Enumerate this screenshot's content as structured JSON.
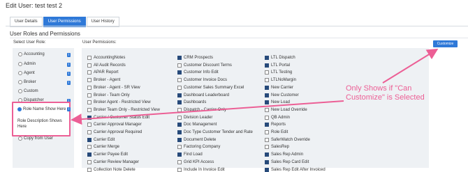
{
  "window": {
    "title": "Edit User: test test 2"
  },
  "tabs": [
    {
      "label": "User Details"
    },
    {
      "label": "User Permissions"
    },
    {
      "label": "User History"
    }
  ],
  "section": {
    "title": "User Roles and Permissions"
  },
  "roles": {
    "heading": "Select User Role:",
    "items": [
      {
        "label": "Accounting"
      },
      {
        "label": "Admin"
      },
      {
        "label": "Agent"
      },
      {
        "label": "Broker"
      },
      {
        "label": "Custom"
      },
      {
        "label": "Dispatcher"
      },
      {
        "label": "Role Name Show Here"
      },
      {
        "label": "Copy from User"
      }
    ],
    "description": "Role Description Shows Here"
  },
  "permissions": {
    "heading": "User Permissions:",
    "columns": [
      [
        {
          "label": "AccountingNotes",
          "checked": false
        },
        {
          "label": "All Audit Records",
          "checked": false
        },
        {
          "label": "APAR Report",
          "checked": false
        },
        {
          "label": "Broker - Agent",
          "checked": false
        },
        {
          "label": "Broker - Agent - SR View",
          "checked": false
        },
        {
          "label": "Broker - Team Only",
          "checked": false
        },
        {
          "label": "Broker Agent - Restricted View",
          "checked": false
        },
        {
          "label": "Broker Team Only - Restricted View",
          "checked": false
        },
        {
          "label": "Carrier / Customer Status Edit",
          "checked": true
        },
        {
          "label": "Carrier Approval Manager",
          "checked": false
        },
        {
          "label": "Carrier Approval Required",
          "checked": false
        },
        {
          "label": "Carrier Edit",
          "checked": true
        },
        {
          "label": "Carrier Merge",
          "checked": false
        },
        {
          "label": "Carrier Payee Edit",
          "checked": true
        },
        {
          "label": "Carrier Review Manager",
          "checked": false
        },
        {
          "label": "Collection Note Delete",
          "checked": false
        }
      ],
      [
        {
          "label": "CRM Prospects",
          "checked": true
        },
        {
          "label": "Customer Discount Terms",
          "checked": false
        },
        {
          "label": "Customer Info Edit",
          "checked": true
        },
        {
          "label": "Customer Invoice Docs",
          "checked": false
        },
        {
          "label": "Customer Sales Summary Excel",
          "checked": false
        },
        {
          "label": "Dashboard Leaderboard",
          "checked": true
        },
        {
          "label": "Dashboards",
          "checked": true
        },
        {
          "label": "Dispatch - Carrier Only",
          "checked": false
        },
        {
          "label": "Division Leader",
          "checked": false
        },
        {
          "label": "Doc Management",
          "checked": true
        },
        {
          "label": "Doc Type Customer Tender and Rate",
          "checked": true
        },
        {
          "label": "Document Delete",
          "checked": true
        },
        {
          "label": "Factoring Company",
          "checked": false
        },
        {
          "label": "Find Load",
          "checked": true
        },
        {
          "label": "Grid KPI Access",
          "checked": false
        },
        {
          "label": "Include In Invoice Edit",
          "checked": false
        }
      ],
      [
        {
          "label": "LTL Dispatch",
          "checked": true
        },
        {
          "label": "LTL Portal",
          "checked": true
        },
        {
          "label": "LTL Testing",
          "checked": false
        },
        {
          "label": "LTLNoMargin",
          "checked": false
        },
        {
          "label": "New Carrier",
          "checked": true
        },
        {
          "label": "New Customer",
          "checked": true
        },
        {
          "label": "New Load",
          "checked": true
        },
        {
          "label": "New Load Override",
          "checked": false
        },
        {
          "label": "QB Admin",
          "checked": false
        },
        {
          "label": "Reports",
          "checked": true
        },
        {
          "label": "Role Edit",
          "checked": false
        },
        {
          "label": "SaferWatch Override",
          "checked": false
        },
        {
          "label": "SalesRep",
          "checked": false
        },
        {
          "label": "Sales Rep Admin",
          "checked": true
        },
        {
          "label": "Sales Rep Card Edit",
          "checked": true
        },
        {
          "label": "Sales Rep Edit After Invoiced",
          "checked": true
        }
      ]
    ]
  },
  "customize_button": {
    "label": "Customize"
  },
  "annotation": {
    "text": "Only Shows if \"Can Customize\" is Selected"
  },
  "colors": {
    "accent": "#2f79d8",
    "highlight": "#ec5f95",
    "checkbox": "#274a7a"
  }
}
